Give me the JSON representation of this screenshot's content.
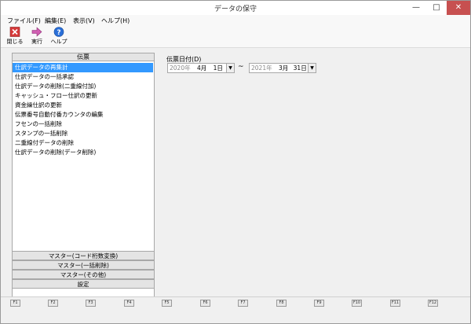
{
  "window": {
    "title": "データの保守"
  },
  "menu": {
    "items": [
      "ファイル(F)",
      "編集(E)",
      "表示(V)",
      "ヘルプ(H)"
    ]
  },
  "toolbar": {
    "buttons": [
      {
        "label": "閉じる",
        "icon": "close-x-icon",
        "color": "#d63a3a"
      },
      {
        "label": "実行",
        "icon": "arrow-right-icon",
        "color": "#d05fb2"
      },
      {
        "label": "ヘルプ",
        "icon": "help-question-icon",
        "color": "#2a6fd8"
      }
    ]
  },
  "panel": {
    "header": "伝票",
    "items": [
      "仕訳データの再集計",
      "仕訳データの一括承認",
      "仕訳データの削除(二重線付加)",
      "キャッシュ・フロー仕訳の更新",
      "資金繰仕訳の更新",
      "伝票番号自動付番カウンタの編集",
      "フセンの一括削除",
      "スタンプの一括削除",
      "二重線付データの削除",
      "仕訳データの削除(データ削除)"
    ],
    "selected_index": 0,
    "sections": [
      "マスター(コード桁数変換)",
      "マスター(一括削除)",
      "マスター(その他)",
      "設定"
    ]
  },
  "date_range": {
    "label": "伝票日付(D)",
    "from": {
      "year": "2020年",
      "month": "4月",
      "day": "1日"
    },
    "separator": "~",
    "to": {
      "year": "2021年",
      "month": "3月",
      "day": "31日"
    }
  },
  "function_keys": [
    "F1",
    "F2",
    "F3",
    "F4",
    "F5",
    "F6",
    "F7",
    "F8",
    "F9",
    "F10",
    "F11",
    "F12"
  ],
  "colors": {
    "selection": "#3399ff",
    "close_button": "#c75050"
  }
}
